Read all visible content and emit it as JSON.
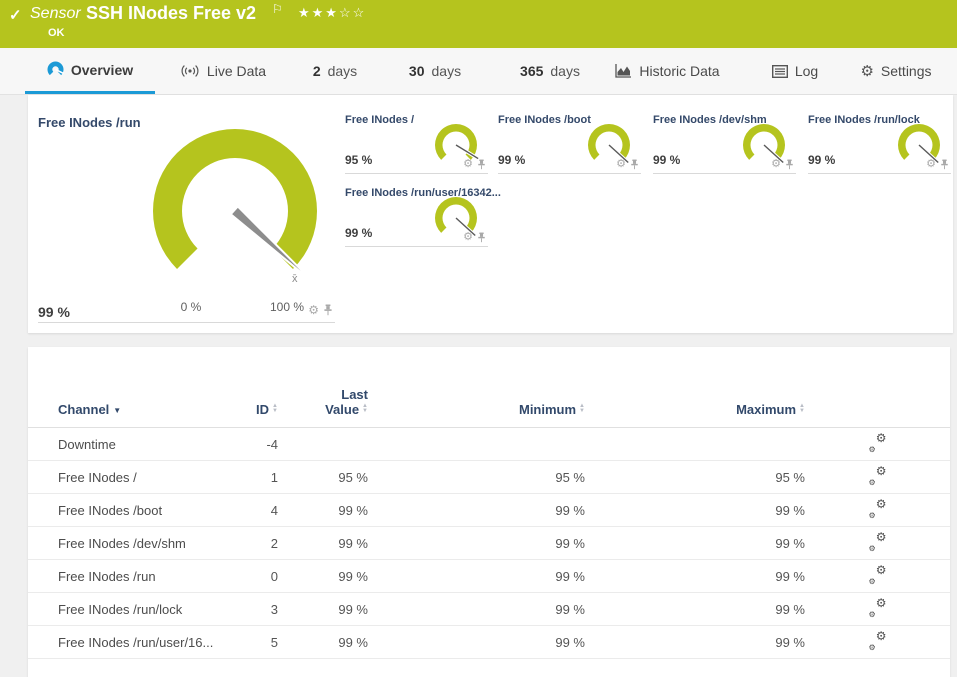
{
  "colors": {
    "accent_green": "#b5c41e",
    "accent_blue": "#1c9ad6",
    "header_text_navy": "#32496b",
    "needle_gray": "#8d8d8d"
  },
  "header": {
    "check": "✓",
    "kind": "Sensor",
    "title": "SSH INodes Free v2",
    "flag": "⚐",
    "stars": "★★★☆☆",
    "status": "OK"
  },
  "tabs": {
    "overview": "Overview",
    "live_data": "Live Data",
    "d2_num": "2",
    "d2_unit": "days",
    "d30_num": "30",
    "d30_unit": "days",
    "d365_num": "365",
    "d365_unit": "days",
    "historic": "Historic Data",
    "log": "Log",
    "settings": "Settings"
  },
  "icons": {
    "gear_glyph": "⚙",
    "overview_icon": "gauge-icon",
    "live_data_icon": "broadcast-icon",
    "historic_icon": "area-chart-icon",
    "log_icon": "list-icon",
    "settings_icon": "gear-icon",
    "pin_icon": "pushpin-icon",
    "channel_settings_icon": "double-gear-icon"
  },
  "gauges": {
    "primary": {
      "title": "Free INodes /run",
      "value": "99 %",
      "percent": 99,
      "scale_min": "0 %",
      "scale_max": "100 %",
      "mean_marker": "x̄"
    },
    "small": [
      {
        "title": "Free INodes /",
        "value": "95 %",
        "percent": 95
      },
      {
        "title": "Free INodes /boot",
        "value": "99 %",
        "percent": 99
      },
      {
        "title": "Free INodes /dev/shm",
        "value": "99 %",
        "percent": 99
      },
      {
        "title": "Free INodes /run/lock",
        "value": "99 %",
        "percent": 99
      },
      {
        "title": "Free INodes /run/user/16342...",
        "value": "99 %",
        "percent": 99
      }
    ]
  },
  "table": {
    "headers": {
      "channel": "Channel",
      "id": "ID",
      "last_line1": "Last",
      "last_line2": "Value",
      "min": "Minimum",
      "max": "Maximum"
    },
    "rows": [
      {
        "channel": "Downtime",
        "id": "-4",
        "last": "",
        "min": "",
        "max": ""
      },
      {
        "channel": "Free INodes /",
        "id": "1",
        "last": "95 %",
        "min": "95 %",
        "max": "95 %"
      },
      {
        "channel": "Free INodes /boot",
        "id": "4",
        "last": "99 %",
        "min": "99 %",
        "max": "99 %"
      },
      {
        "channel": "Free INodes /dev/shm",
        "id": "2",
        "last": "99 %",
        "min": "99 %",
        "max": "99 %"
      },
      {
        "channel": "Free INodes /run",
        "id": "0",
        "last": "99 %",
        "min": "99 %",
        "max": "99 %"
      },
      {
        "channel": "Free INodes /run/lock",
        "id": "3",
        "last": "99 %",
        "min": "99 %",
        "max": "99 %"
      },
      {
        "channel": "Free INodes /run/user/16...",
        "id": "5",
        "last": "99 %",
        "min": "99 %",
        "max": "99 %"
      }
    ]
  }
}
